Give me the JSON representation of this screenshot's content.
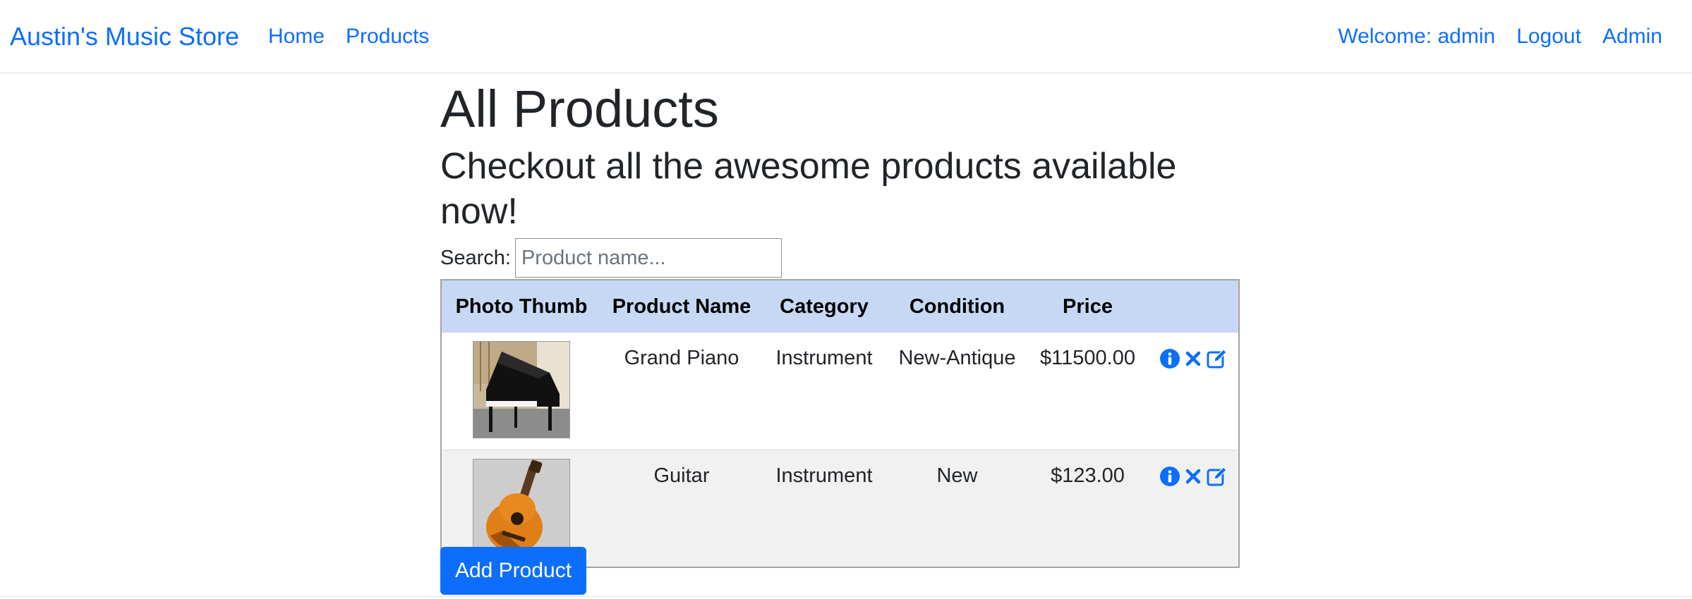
{
  "navbar": {
    "brand": "Austin's Music Store",
    "links": {
      "home": "Home",
      "products": "Products"
    },
    "welcome": "Welcome: admin",
    "logout": "Logout",
    "admin": "Admin"
  },
  "main": {
    "title": "All Products",
    "subtitle": "Checkout all the awesome products available now!"
  },
  "search": {
    "label": "Search:",
    "placeholder": "Product name...",
    "value": ""
  },
  "table": {
    "headers": [
      "Photo Thumb",
      "Product Name",
      "Category",
      "Condition",
      "Price",
      ""
    ],
    "rows": [
      {
        "thumb": "grand-piano-photo",
        "name": "Grand Piano",
        "category": "Instrument",
        "condition": "New-Antique",
        "price": "$11500.00"
      },
      {
        "thumb": "guitar-photo",
        "name": "Guitar",
        "category": "Instrument",
        "condition": "New",
        "price": "$123.00"
      }
    ],
    "action_icons": [
      "info-icon",
      "delete-icon",
      "edit-icon"
    ]
  },
  "add_button": "Add Product",
  "colors": {
    "primary": "#0d6efd",
    "header_bg": "#c6d8f4",
    "stripe_bg": "#f1f1f1"
  }
}
